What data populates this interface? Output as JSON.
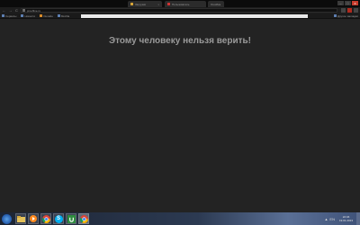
{
  "tabs": [
    {
      "label": "Загрузки",
      "close": "x"
    },
    {
      "label": "Пользователь"
    },
    {
      "label": "Ошибка"
    }
  ],
  "window_controls": {
    "minimize": "–",
    "maximize": "□",
    "close": "x"
  },
  "toolbar": {
    "back": "←",
    "forward": "→",
    "reload": "C",
    "address": "proofline.ru"
  },
  "bookmarks": [
    {
      "label": "Сервисы"
    },
    {
      "label": "Новости"
    },
    {
      "label": "Онлайн"
    },
    {
      "label": "Mozilla"
    }
  ],
  "other_bookmarks": "Другие закладки",
  "page": {
    "message": "Этому человеку нельзя верить!"
  },
  "taskbar": {
    "apps": [
      {
        "name": "explorer"
      },
      {
        "name": "media"
      },
      {
        "name": "chrome"
      },
      {
        "name": "skype",
        "glyph": "S"
      },
      {
        "name": "utorrent"
      },
      {
        "name": "chrome-active"
      }
    ],
    "tray": {
      "flag": "▲",
      "lang": "EN"
    },
    "clock": {
      "time": "22:46",
      "date": "19.01.2013"
    }
  }
}
